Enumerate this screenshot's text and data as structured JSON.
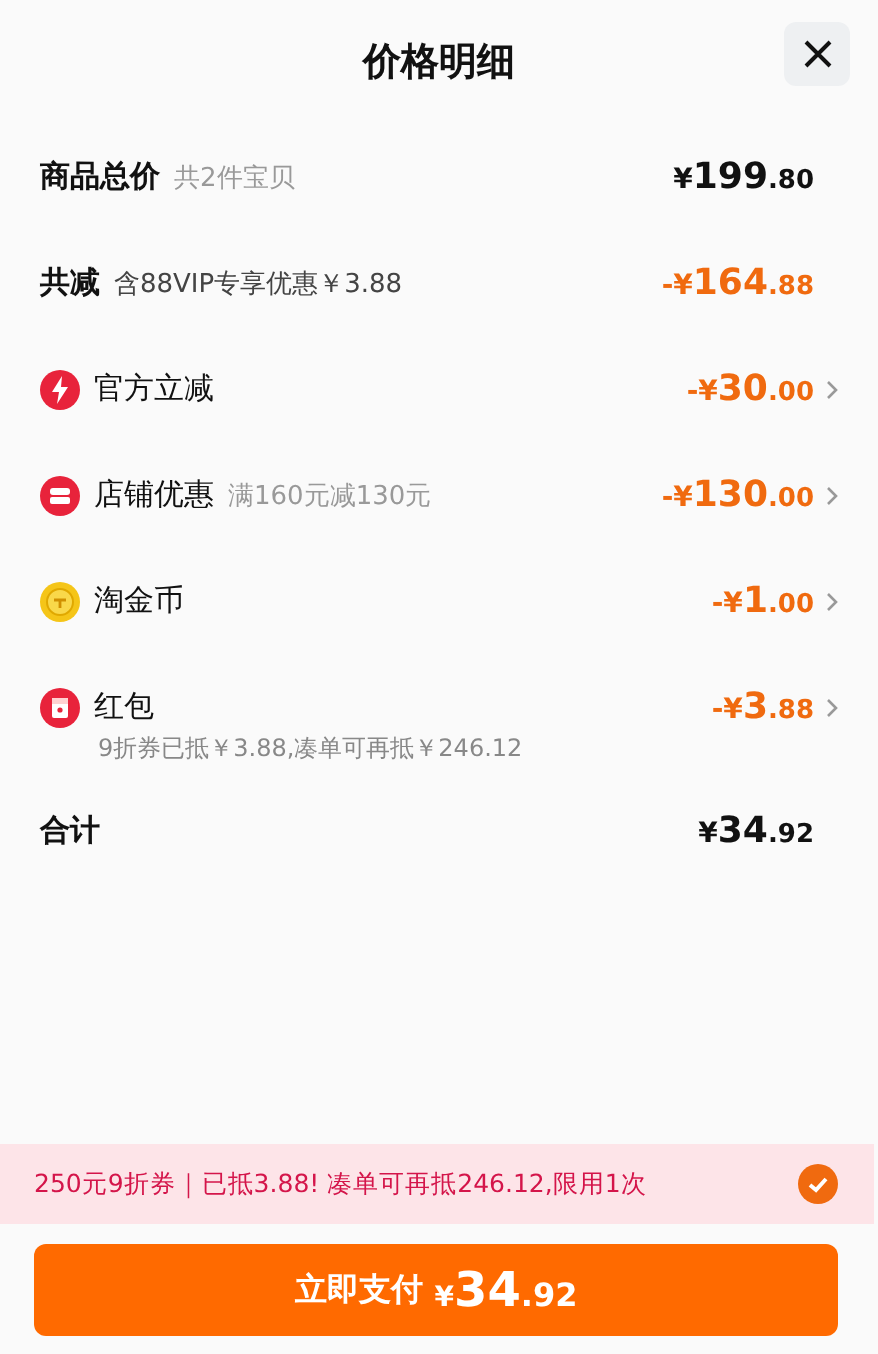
{
  "title": "价格明细",
  "rows": [
    {
      "kind": "heading",
      "label": "商品总价",
      "detail": "共2件宝贝",
      "price": {
        "symbol": "¥",
        "main": "199",
        "cents": ".80"
      },
      "discount": false,
      "chevron": false
    },
    {
      "kind": "heading",
      "label": "共减",
      "detail": "含88VIP专享优惠￥3.88",
      "price": {
        "symbol": "-¥",
        "main": "164",
        "cents": ".88"
      },
      "discount": true,
      "chevron": false
    },
    {
      "kind": "bolt",
      "label": "官方立减",
      "price": {
        "symbol": "-¥",
        "main": "30",
        "cents": ".00"
      },
      "discount": true,
      "chevron": true
    },
    {
      "kind": "store",
      "label": "店铺优惠",
      "detail": "满160元减130元",
      "price": {
        "symbol": "-¥",
        "main": "130",
        "cents": ".00"
      },
      "discount": true,
      "chevron": true
    },
    {
      "kind": "coin",
      "label": "淘金币",
      "price": {
        "symbol": "-¥",
        "main": "1",
        "cents": ".00"
      },
      "discount": true,
      "chevron": true
    },
    {
      "kind": "packet",
      "label": "红包",
      "note": "9折券已抵￥3.88,凑单可再抵￥246.12",
      "price": {
        "symbol": "-¥",
        "main": "3",
        "cents": ".88"
      },
      "discount": true,
      "chevron": true
    },
    {
      "kind": "heading",
      "label": "合计",
      "price": {
        "symbol": "¥",
        "main": "34",
        "cents": ".92"
      },
      "discount": false,
      "chevron": false
    }
  ],
  "banner": {
    "text": "250元9折券｜已抵3.88! 凑单可再抵246.12,限用1次",
    "checked": true
  },
  "pay_button": {
    "label": "立即支付",
    "price": {
      "symbol": "¥",
      "main": "34",
      "cents": ".92"
    }
  }
}
